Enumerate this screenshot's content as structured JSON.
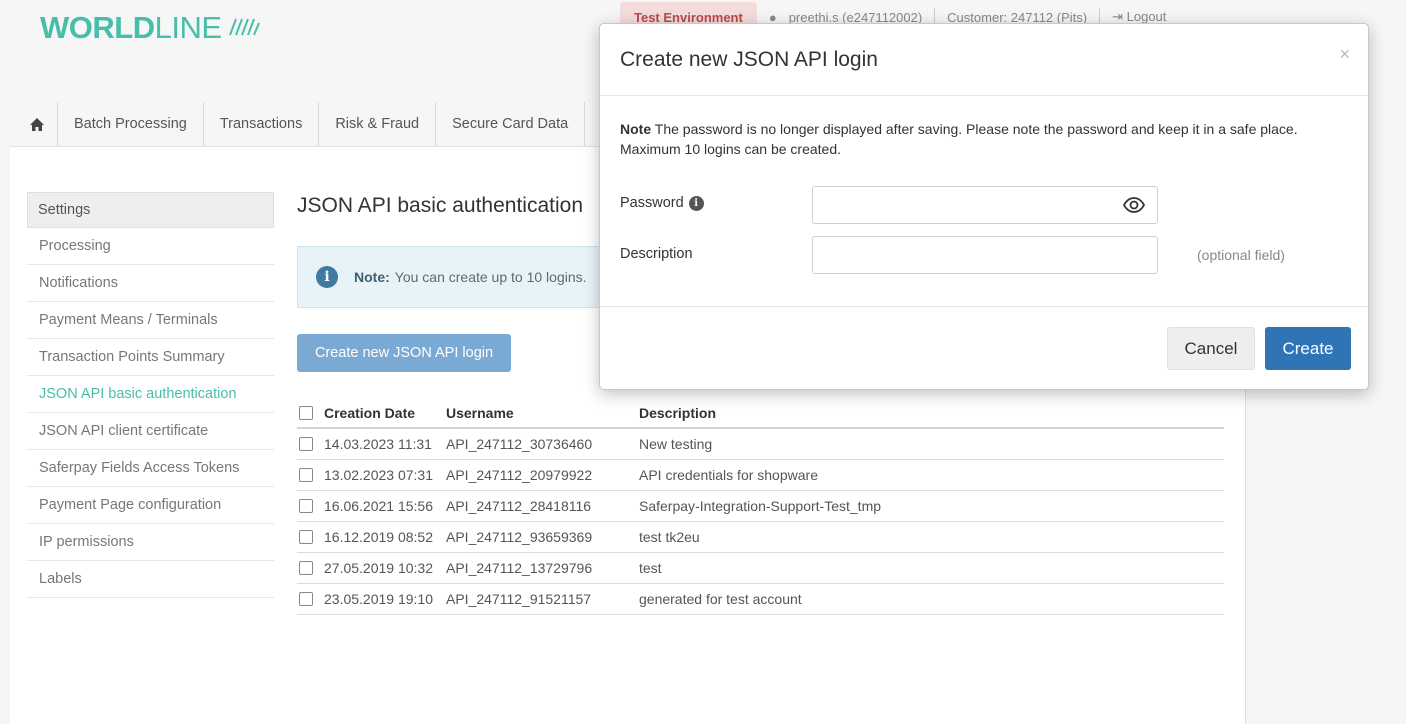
{
  "brand": {
    "name_bold": "WORLD",
    "name_thin": "LINE",
    "color": "#46beaa"
  },
  "topbar": {
    "environment": "Test Environment",
    "user": "preethi.s (e247112002)",
    "customer": "Customer: 247112 (Pits)",
    "logout": "Logout"
  },
  "nav": {
    "items": [
      {
        "label": "Batch Processing"
      },
      {
        "label": "Transactions"
      },
      {
        "label": "Risk & Fraud"
      },
      {
        "label": "Secure Card Data"
      }
    ]
  },
  "sidebar": {
    "heading": "Settings",
    "items": [
      {
        "label": "Processing"
      },
      {
        "label": "Notifications"
      },
      {
        "label": "Payment Means / Terminals"
      },
      {
        "label": "Transaction Points Summary"
      },
      {
        "label": "JSON API basic authentication",
        "active": true
      },
      {
        "label": "JSON API client certificate"
      },
      {
        "label": "Saferpay Fields Access Tokens"
      },
      {
        "label": "Payment Page configuration"
      },
      {
        "label": "IP permissions"
      },
      {
        "label": "Labels"
      }
    ]
  },
  "main": {
    "title": "JSON API basic authentication",
    "note_bold": "Note:",
    "note_text": "You can create up to 10 logins.",
    "create_button": "Create new JSON API login",
    "table": {
      "headers": {
        "date": "Creation Date",
        "user": "Username",
        "desc": "Description"
      },
      "rows": [
        {
          "date": "14.03.2023 11:31",
          "user": "API_247112_30736460",
          "desc": "New testing"
        },
        {
          "date": "13.02.2023 07:31",
          "user": "API_247112_20979922",
          "desc": "API credentials for shopware"
        },
        {
          "date": "16.06.2021 15:56",
          "user": "API_247112_28418116",
          "desc": "Saferpay-Integration-Support-Test_tmp"
        },
        {
          "date": "16.12.2019 08:52",
          "user": "API_247112_93659369",
          "desc": "test tk2eu"
        },
        {
          "date": "27.05.2019 10:32",
          "user": "API_247112_13729796",
          "desc": "test"
        },
        {
          "date": "23.05.2019 19:10",
          "user": "API_247112_91521157",
          "desc": "generated for test account"
        }
      ]
    }
  },
  "modal": {
    "title": "Create new JSON API login",
    "close": "×",
    "note_bold": "Note",
    "note_text": "The password is no longer displayed after saving. Please note the password and keep it in a safe place. Maximum 10 logins can be created.",
    "password_label": "Password",
    "password_value": "",
    "description_label": "Description",
    "description_value": "",
    "optional_hint": "(optional field)",
    "cancel": "Cancel",
    "create": "Create"
  }
}
